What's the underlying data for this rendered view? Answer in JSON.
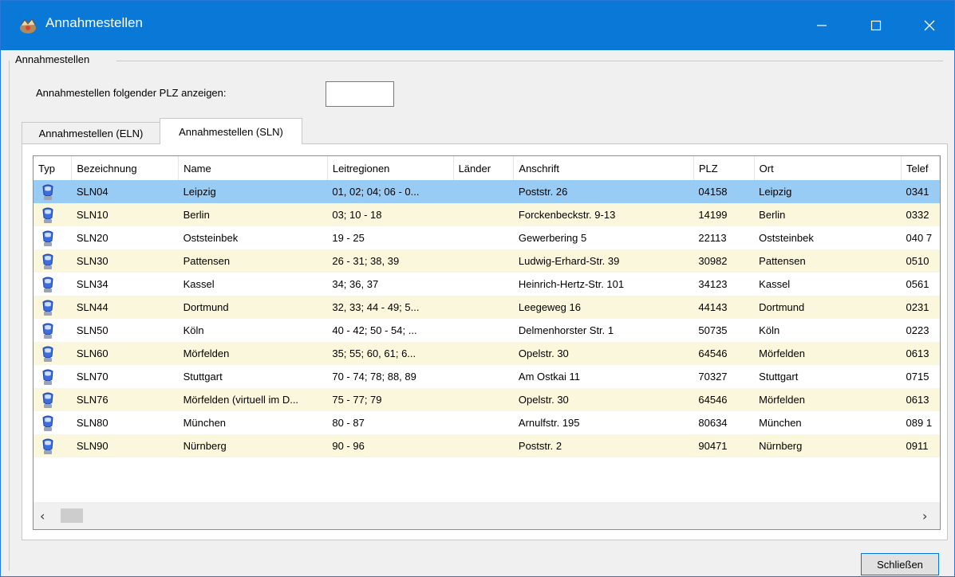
{
  "window": {
    "title": "Annahmestellen",
    "accent": "#0a78d7",
    "controls": {
      "minimize": "minimize-icon",
      "maximize": "maximize-icon",
      "close": "close-icon"
    }
  },
  "group": {
    "label": "Annahmestellen"
  },
  "filter": {
    "label": "Annahmestellen folgender PLZ anzeigen:",
    "value": ""
  },
  "tabs": [
    {
      "label": "Annahmestellen (ELN)",
      "active": false
    },
    {
      "label": "Annahmestellen (SLN)",
      "active": true
    }
  ],
  "table": {
    "columns": [
      "Typ",
      "Bezeichnung",
      "Name",
      "Leitregionen",
      "Länder",
      "Anschrift",
      "PLZ",
      "Ort",
      "Telef"
    ],
    "rows": [
      {
        "typ": "depot-icon",
        "bezeichnung": "SLN04",
        "name": "Leipzig",
        "leitregionen": "01, 02; 04; 06 - 0...",
        "laender": "",
        "anschrift": "Poststr. 26",
        "plz": "04158",
        "ort": "Leipzig",
        "telefon": "0341"
      },
      {
        "typ": "depot-icon",
        "bezeichnung": "SLN10",
        "name": "Berlin",
        "leitregionen": "03; 10 - 18",
        "laender": "",
        "anschrift": "Forckenbeckstr. 9-13",
        "plz": "14199",
        "ort": "Berlin",
        "telefon": "0332"
      },
      {
        "typ": "depot-icon",
        "bezeichnung": "SLN20",
        "name": "Oststeinbek",
        "leitregionen": "19 - 25",
        "laender": "",
        "anschrift": "Gewerbering 5",
        "plz": "22113",
        "ort": "Oststeinbek",
        "telefon": "040 7"
      },
      {
        "typ": "depot-icon",
        "bezeichnung": "SLN30",
        "name": "Pattensen",
        "leitregionen": "26 - 31; 38, 39",
        "laender": "",
        "anschrift": "Ludwig-Erhard-Str. 39",
        "plz": "30982",
        "ort": "Pattensen",
        "telefon": "0510"
      },
      {
        "typ": "depot-icon",
        "bezeichnung": "SLN34",
        "name": "Kassel",
        "leitregionen": "34; 36, 37",
        "laender": "",
        "anschrift": "Heinrich-Hertz-Str. 101",
        "plz": "34123",
        "ort": "Kassel",
        "telefon": "0561"
      },
      {
        "typ": "depot-icon",
        "bezeichnung": "SLN44",
        "name": "Dortmund",
        "leitregionen": "32, 33; 44 - 49; 5...",
        "laender": "",
        "anschrift": "Leegeweg 16",
        "plz": "44143",
        "ort": "Dortmund",
        "telefon": "0231"
      },
      {
        "typ": "depot-icon",
        "bezeichnung": "SLN50",
        "name": "Köln",
        "leitregionen": "40 - 42; 50 - 54; ...",
        "laender": "",
        "anschrift": "Delmenhorster Str. 1",
        "plz": "50735",
        "ort": "Köln",
        "telefon": "0223"
      },
      {
        "typ": "depot-icon",
        "bezeichnung": "SLN60",
        "name": "Mörfelden",
        "leitregionen": "35; 55; 60, 61; 6...",
        "laender": "",
        "anschrift": "Opelstr. 30",
        "plz": "64546",
        "ort": "Mörfelden",
        "telefon": "0613"
      },
      {
        "typ": "depot-icon",
        "bezeichnung": "SLN70",
        "name": "Stuttgart",
        "leitregionen": "70 - 74; 78; 88, 89",
        "laender": "",
        "anschrift": "Am Ostkai 11",
        "plz": "70327",
        "ort": "Stuttgart",
        "telefon": "0715"
      },
      {
        "typ": "depot-icon",
        "bezeichnung": "SLN76",
        "name": "Mörfelden (virtuell im D...",
        "leitregionen": "75 - 77; 79",
        "laender": "",
        "anschrift": "Opelstr. 30",
        "plz": "64546",
        "ort": "Mörfelden",
        "telefon": "0613"
      },
      {
        "typ": "depot-icon",
        "bezeichnung": "SLN80",
        "name": "München",
        "leitregionen": "80 - 87",
        "laender": "",
        "anschrift": "Arnulfstr. 195",
        "plz": "80634",
        "ort": "München",
        "telefon": "089 1"
      },
      {
        "typ": "depot-icon",
        "bezeichnung": "SLN90",
        "name": "Nürnberg",
        "leitregionen": "90 - 96",
        "laender": "",
        "anschrift": "Poststr. 2",
        "plz": "90471",
        "ort": "Nürnberg",
        "telefon": "0911"
      }
    ],
    "selected_index": 0,
    "colors": {
      "selected": "#99ccf5",
      "alternate": "#fbf7dc"
    }
  },
  "scrollbar": {
    "left": "‹",
    "right": "›"
  },
  "buttons": {
    "close": "Schließen"
  }
}
